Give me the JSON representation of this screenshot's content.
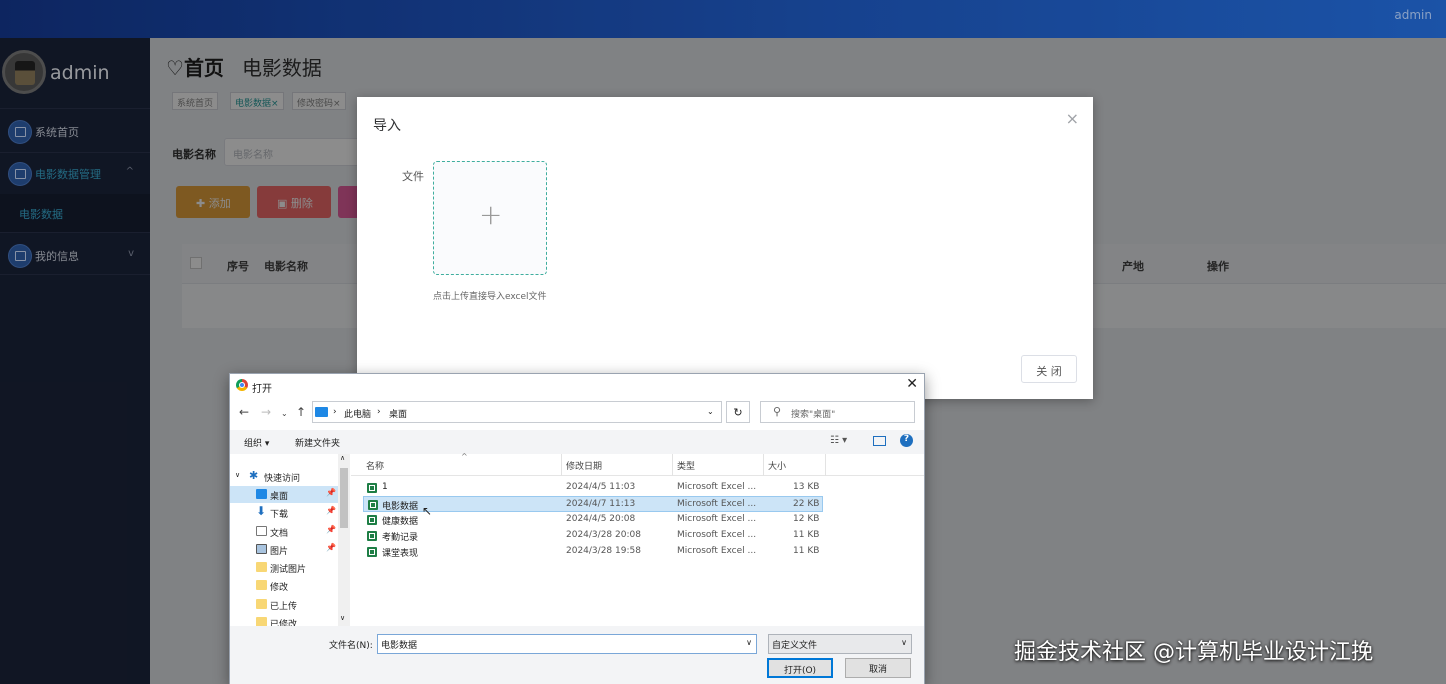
{
  "topbar": {
    "user": "admin"
  },
  "sidebar": {
    "username": "admin",
    "items": [
      {
        "label": "系统首页",
        "icon": "home-icon"
      },
      {
        "label": "电影数据管理",
        "icon": "chart-icon",
        "chevron": "^"
      },
      {
        "label": "电影数据",
        "sub": true
      },
      {
        "label": "我的信息",
        "icon": "card-icon",
        "chevron": "v"
      }
    ]
  },
  "content": {
    "title_icon": "♡",
    "title": "首页",
    "subtitle": "电影数据",
    "tabs": [
      {
        "label": "系统首页"
      },
      {
        "label": "电影数据",
        "close": "×"
      },
      {
        "label": "修改密码",
        "close": "×"
      }
    ],
    "filter": {
      "label": "电影名称",
      "placeholder": "电影名称"
    },
    "buttons": {
      "add": "添加",
      "delete": "删除"
    },
    "table_headers": [
      "序号",
      "电影名称",
      "产地",
      "操作"
    ]
  },
  "import_dialog": {
    "title": "导入",
    "close_glyph": "×",
    "file_label": "文件",
    "hint": "点击上传直接导入excel文件",
    "close_button": "关 闭"
  },
  "file_dialog": {
    "title": "打开",
    "address": [
      "此电脑",
      "桌面"
    ],
    "search_placeholder": "搜索\"桌面\"",
    "toolbar": {
      "organize": "组织 ▾",
      "new_folder": "新建文件夹"
    },
    "nav": [
      {
        "label": "快速访问",
        "kind": "quick"
      },
      {
        "label": "桌面",
        "kind": "desktop",
        "pinned": true,
        "selected": true
      },
      {
        "label": "下载",
        "kind": "download",
        "pinned": true
      },
      {
        "label": "文档",
        "kind": "doc",
        "pinned": true
      },
      {
        "label": "图片",
        "kind": "pic",
        "pinned": true
      },
      {
        "label": "测试图片",
        "kind": "folder"
      },
      {
        "label": "修改",
        "kind": "folder"
      },
      {
        "label": "已上传",
        "kind": "folder"
      },
      {
        "label": "已修改",
        "kind": "folder"
      }
    ],
    "columns": [
      "名称",
      "修改日期",
      "类型",
      "大小"
    ],
    "files": [
      {
        "name": "1",
        "date": "2024/4/5 11:03",
        "type": "Microsoft Excel ...",
        "size": "13 KB"
      },
      {
        "name": "电影数据",
        "date": "2024/4/7 11:13",
        "type": "Microsoft Excel ...",
        "size": "22 KB",
        "selected": true
      },
      {
        "name": "健康数据",
        "date": "2024/4/5 20:08",
        "type": "Microsoft Excel ...",
        "size": "12 KB"
      },
      {
        "name": "考勤记录",
        "date": "2024/3/28 20:08",
        "type": "Microsoft Excel ...",
        "size": "11 KB"
      },
      {
        "name": "课堂表现",
        "date": "2024/3/28 19:58",
        "type": "Microsoft Excel ...",
        "size": "11 KB"
      }
    ],
    "filename_label": "文件名(N):",
    "filename_value": "电影数据",
    "filetype_value": "自定义文件",
    "open_button": "打开(O)",
    "cancel_button": "取消"
  },
  "watermark": "掘金技术社区 @计算机毕业设计江挽",
  "colors": {
    "accent": "#36a3c8",
    "add": "#e6a23c",
    "delete": "#f56c6c",
    "sidebar": "#1a2238"
  }
}
